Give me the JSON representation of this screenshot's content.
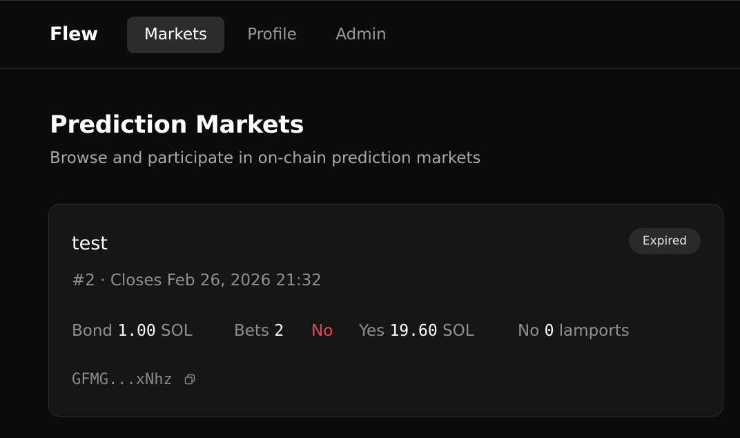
{
  "brand": "Flew",
  "nav": {
    "items": [
      {
        "label": "Markets",
        "active": true
      },
      {
        "label": "Profile",
        "active": false
      },
      {
        "label": "Admin",
        "active": false
      }
    ]
  },
  "header": {
    "title": "Prediction Markets",
    "subtitle": "Browse and participate in on-chain prediction markets"
  },
  "market": {
    "title": "test",
    "status": "Expired",
    "meta": "#2 · Closes Feb 26, 2026 21:32",
    "bond_label": "Bond",
    "bond_value": "1.00",
    "bond_unit": "SOL",
    "bets_label": "Bets",
    "bets_value": "2",
    "outcome": "No",
    "yes_label": "Yes",
    "yes_value": "19.60",
    "yes_unit": "SOL",
    "no_label": "No",
    "no_value": "0",
    "no_unit": "lamports",
    "address": "GFMG...xNhz",
    "icons": {
      "copy": "copy-icon"
    }
  },
  "colors": {
    "background": "#0b0b0b",
    "card": "#161616",
    "accent_no": "#e8465a",
    "nav_active": "#2c2c2c"
  }
}
